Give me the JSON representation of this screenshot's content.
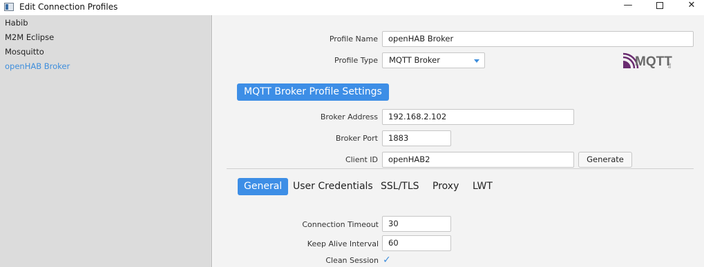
{
  "window": {
    "title": "Edit Connection Profiles",
    "controls": {
      "minimize": "—",
      "close": "✕"
    }
  },
  "sidebar": {
    "items": [
      {
        "label": "Habib",
        "selected": false
      },
      {
        "label": "M2M Eclipse",
        "selected": false
      },
      {
        "label": "Mosquitto",
        "selected": false
      },
      {
        "label": "openHAB Broker",
        "selected": true
      }
    ]
  },
  "profile": {
    "name_label": "Profile Name",
    "name_value": "openHAB Broker",
    "type_label": "Profile Type",
    "type_value": "MQTT Broker",
    "logo_text": "MQTT",
    "logo_sub": ".org"
  },
  "broker_section": {
    "title": "MQTT Broker Profile Settings",
    "address_label": "Broker Address",
    "address_value": "192.168.2.102",
    "port_label": "Broker Port",
    "port_value": "1883",
    "client_id_label": "Client ID",
    "client_id_value": "openHAB2",
    "generate_label": "Generate"
  },
  "tabs": [
    {
      "label": "General",
      "active": true
    },
    {
      "label": "User Credentials",
      "active": false
    },
    {
      "label": "SSL/TLS",
      "active": false
    },
    {
      "label": "Proxy",
      "active": false
    },
    {
      "label": "LWT",
      "active": false
    }
  ],
  "general": {
    "timeout_label": "Connection Timeout",
    "timeout_value": "30",
    "keepalive_label": "Keep Alive Interval",
    "keepalive_value": "60",
    "clean_session_label": "Clean Session",
    "clean_session_checked": true,
    "check_glyph": "✓"
  },
  "colors": {
    "accent": "#3d8ee6",
    "selected_text": "#3e8edc",
    "sidebar_bg": "#dcdcdc",
    "panel_bg": "#f3f3f3",
    "logo_purple": "#6a2c70"
  }
}
